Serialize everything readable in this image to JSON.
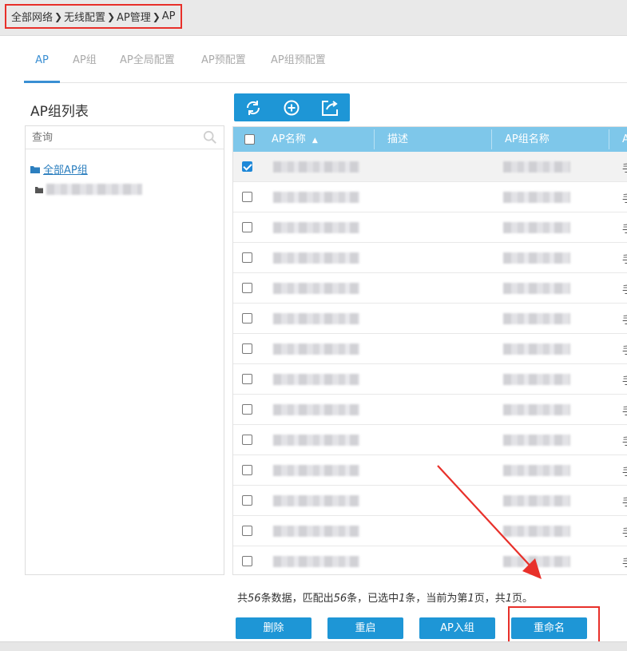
{
  "breadcrumb": [
    "全部网络",
    "无线配置",
    "AP管理",
    "AP"
  ],
  "tabs": [
    "AP",
    "AP组",
    "AP全局配置",
    "AP预配置",
    "AP组预配置"
  ],
  "active_tab": "AP",
  "left": {
    "title": "AP组列表",
    "search_placeholder": "查询",
    "root_label": "全部AP组"
  },
  "toolbar": {
    "icons": [
      "refresh-icon",
      "add-icon",
      "export-icon"
    ]
  },
  "table": {
    "columns": [
      "AP名称",
      "描述",
      "AP组名称",
      "A"
    ],
    "sort": "ascending",
    "row_count_visible": 14,
    "last_col_glyph": "手",
    "selected_rows": [
      0
    ]
  },
  "info": {
    "prefix": "共",
    "total": "56",
    "mid1": "条数据，匹配出",
    "matched": "56",
    "mid2": "条，已选中",
    "selected": "1",
    "mid3": "条，当前为第",
    "page": "1",
    "mid4": "页，共",
    "pages": "1",
    "suffix": "页。"
  },
  "buttons": [
    "删除",
    "重启",
    "AP入组",
    "重命名"
  ],
  "colors": {
    "accent": "#1e96d6",
    "header": "#7ec7ea",
    "highlight": "#e8302a",
    "link": "#2c7fbf"
  }
}
